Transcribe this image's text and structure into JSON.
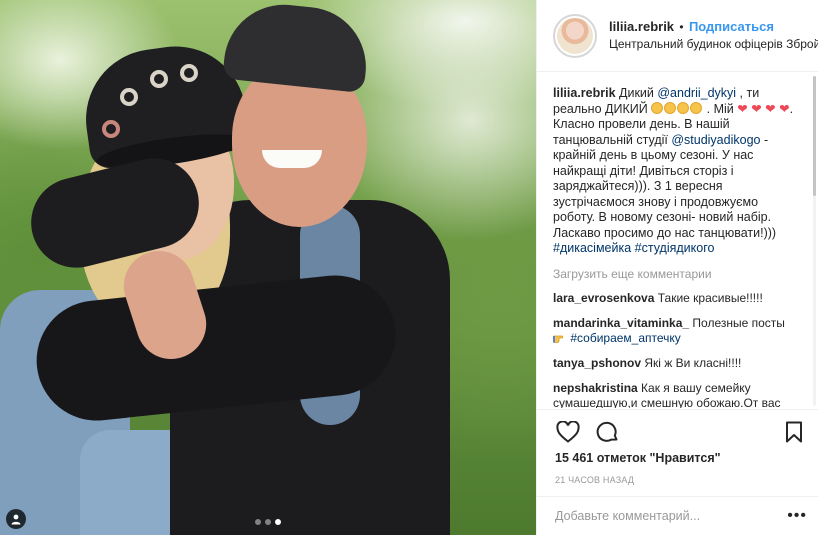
{
  "header": {
    "username": "liliia.rebrik",
    "separator": "•",
    "follow_label": "Подписаться",
    "location": "Центральний будинок офіцерів Збройн..."
  },
  "caption": {
    "username": "liliia.rebrik",
    "t1": " Дикий ",
    "mention1": "@andrii_dykyi",
    "t2": " , ти реально ДИКИЙ ",
    "t3": " . Мій ",
    "hearts": "❤ ❤ ❤ ❤",
    "t4": ". Класно провели день. В нашій танцювальній студії ",
    "mention2": "@studiyadikogo",
    "t5": " - крайній день в цьому сезоні. У нас найкращі діти! Дивіться сторіз і заряджайтеся))). З 1 вересня зустрічаємося знову і продовжуємо роботу. В новому сезоні- новий набір. Ласкаво просимо до нас танцювати!)))",
    "hashtags": "#дикасімейка #студіядикого"
  },
  "load_more_label": "Загрузить еще комментарии",
  "comments": [
    {
      "username": "lara_evrosenkova",
      "text": " Такие красивые!!!!!"
    },
    {
      "username": "mandarinka_vitaminka_",
      "text": " Полезные посты ",
      "hashtag": "#собираем_аптечку"
    },
    {
      "username": "tanya_pshonov",
      "text": " Які ж Ви класні!!!!"
    },
    {
      "username": "nepshakristina",
      "text": " Как я вашу семейку сумашедшую,и смешную обожаю.От вас веет таким теплом и радостью что"
    }
  ],
  "likes_text": "15 461 отметок \"Нравится\"",
  "timestamp": "21 часов назад",
  "add_comment_placeholder": "Добавьте комментарий...",
  "more_label": "•••",
  "carousel": {
    "count": 3,
    "active_index": 2
  },
  "icons": {
    "like": "heart-outline-icon",
    "comment": "speech-bubble-icon",
    "save": "bookmark-icon",
    "tag": "person-tag-icon",
    "point": "pointing-hand-emoji"
  },
  "colors": {
    "link_blue": "#3897f0",
    "mention": "#003569",
    "heart": "#ed4956",
    "muted": "#999999"
  }
}
